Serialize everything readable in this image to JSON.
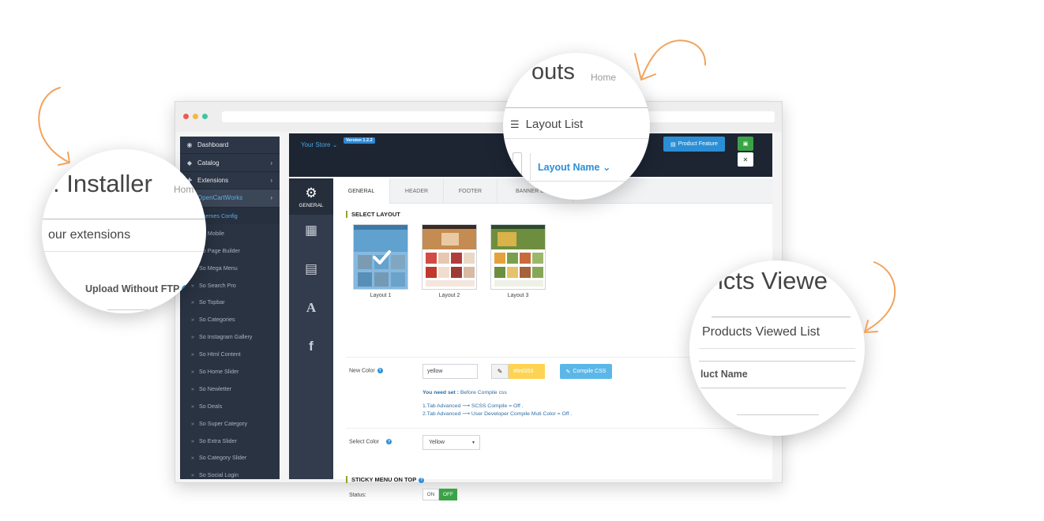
{
  "window": {
    "url": ""
  },
  "sidebar": {
    "items": [
      {
        "label": "Dashboard",
        "icon": "dashboard-icon",
        "glyph": "◉",
        "has_children": false
      },
      {
        "label": "Catalog",
        "icon": "tag-icon",
        "glyph": "◆",
        "has_children": true
      },
      {
        "label": "Extensions",
        "icon": "puzzle-icon",
        "glyph": "✚",
        "has_children": true
      },
      {
        "label": "OpenCartWorks",
        "icon": "cube-icon",
        "glyph": "■",
        "has_children": true
      }
    ],
    "sub_items": [
      "Themes Config",
      "So Mobile",
      "So Page Builder",
      "So Mega Menu",
      "So Search Pro",
      "So Topbar",
      "So Categories",
      "So Instagram Gallery",
      "So Html Content",
      "So Home Slider",
      "So Newletter",
      "So Deals",
      "So Super Category",
      "So Extra Slider",
      "So Category Slider",
      "So Social Login"
    ]
  },
  "topbar": {
    "store": "Your Store ⌄",
    "version": "Version 1.2.2",
    "feature_button": "Product Feature",
    "save_icon": "save-icon",
    "close_label": "✕"
  },
  "rail": {
    "general_label": "GENERAL",
    "icons": [
      "gear-icon",
      "grid-icon",
      "document-icon",
      "font-icon",
      "facebook-icon"
    ]
  },
  "tabs": [
    "GENERAL",
    "HEADER",
    "FOOTER",
    "BANNER EFFE"
  ],
  "select_layout": {
    "title": "SELECT LAYOUT",
    "layouts": [
      "Layout 1",
      "Layout 2",
      "Layout 3"
    ],
    "selected": 0
  },
  "new_color": {
    "label": "New Color",
    "value": "yellow",
    "hex_label": "#fed353",
    "swatch_color": "#fed353",
    "compile_button": "Compile CSS",
    "note_bold": "You need set :",
    "note_text": " Before Compile css",
    "note_line1": "1.Tab Advanced ⟶ SCSS Compile = Off .",
    "note_line2": "2.Tab Advanced ⟶ User Developer Compile Muti Color = Off ."
  },
  "select_color": {
    "label": "Select Color",
    "value": "Yellow"
  },
  "sticky_menu": {
    "title": "STICKY MENU ON TOP",
    "status_label": "Status:",
    "on_label": "ON",
    "off_label": "OFF"
  },
  "magnifiers": {
    "installer": {
      "title": ". Installer",
      "crumb": "Hom",
      "subtitle": "our extensions",
      "upload": "Upload Without FTP"
    },
    "layouts": {
      "title": "outs",
      "crumb": "Home",
      "list": "Layout List",
      "column": "Layout Name ⌄"
    },
    "viewed": {
      "title": "icts Viewe",
      "list": "Products Viewed List",
      "column": "luct Name"
    }
  },
  "colors": {
    "accent_blue": "#2b8fd6",
    "accent_green": "#3aa346",
    "sidebar_bg": "#2c3646",
    "topbar_bg": "#1d2533",
    "arrow_orange": "#f2a35d"
  }
}
